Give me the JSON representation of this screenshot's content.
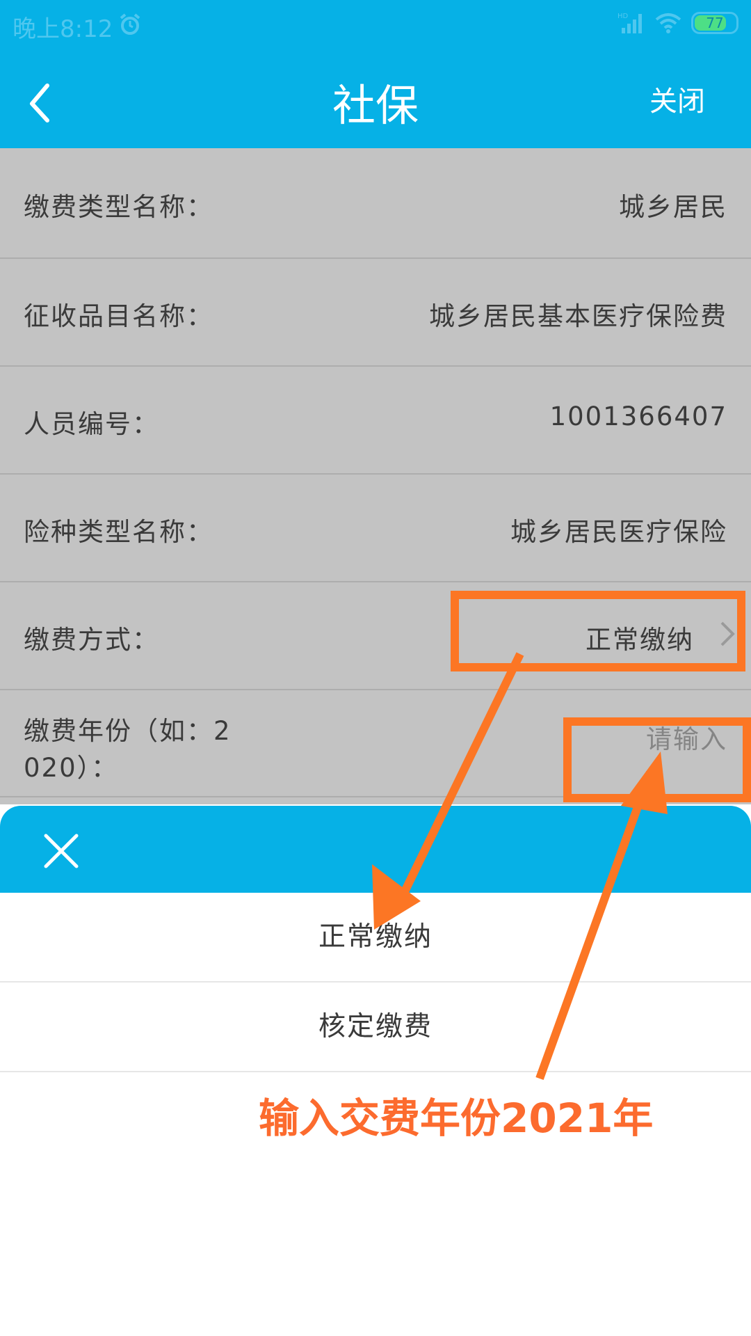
{
  "status_bar": {
    "time": "晚上8:12",
    "battery_percent": "77",
    "network_label": "HD",
    "icons": [
      "alarm-icon",
      "signal-icon",
      "wifi-icon",
      "battery-icon"
    ]
  },
  "header": {
    "title": "社保",
    "close_label": "关闭",
    "back_icon": "chevron-left-icon"
  },
  "form": {
    "rows": [
      {
        "label": "缴费类型名称：",
        "value": "城乡居民"
      },
      {
        "label": "征收品目名称：",
        "value": "城乡居民基本医疗保险费"
      },
      {
        "label": "人员编号：",
        "value": "1001366407"
      },
      {
        "label": "险种类型名称：",
        "value": "城乡居民医疗保险"
      },
      {
        "label": "缴费方式：",
        "value": "正常缴纳"
      },
      {
        "label_line1": "缴费年份（如：2",
        "label_line2": "020）：",
        "placeholder": "请输入"
      }
    ]
  },
  "sheet": {
    "close_icon": "close-icon",
    "options": [
      "正常缴纳",
      "核定缴费"
    ]
  },
  "annotation": {
    "text": "输入交费年份2021年",
    "color": "#fc7624"
  },
  "colors": {
    "brand": "#06b1e6",
    "dim_background": "#c3c3c3"
  }
}
